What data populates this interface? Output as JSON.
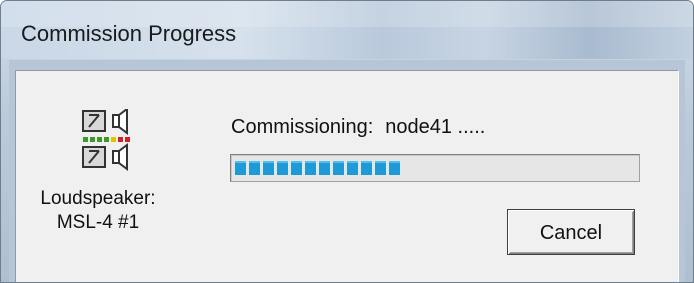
{
  "window": {
    "title": "Commission Progress"
  },
  "device": {
    "icon": "loudspeaker-icon",
    "label_line1": "Loudspeaker:",
    "label_line2": "MSL-4 #1"
  },
  "status": {
    "prefix": "Commissioning:",
    "node": "node41 ....."
  },
  "progress": {
    "filled_segments": 12,
    "total_segments": 29,
    "fraction": 0.41,
    "color": "#1e9bd6"
  },
  "buttons": {
    "cancel_label": "Cancel"
  }
}
